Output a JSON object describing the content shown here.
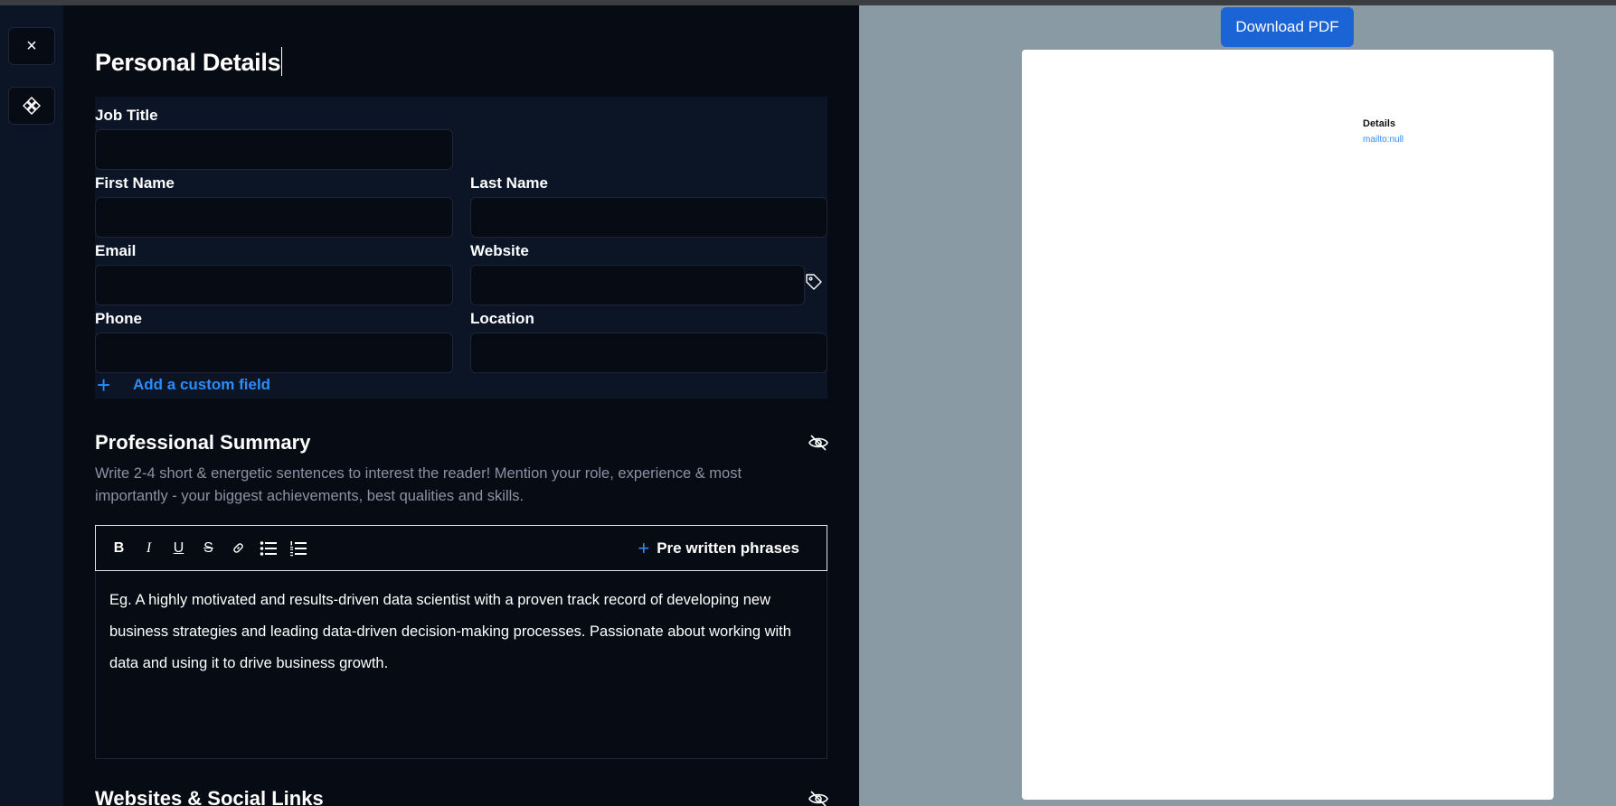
{
  "rail": {
    "close_glyph": "×"
  },
  "editor": {
    "title": "Personal Details",
    "fields": {
      "job_title": {
        "label": "Job Title",
        "value": ""
      },
      "first_name": {
        "label": "First Name",
        "value": ""
      },
      "last_name": {
        "label": "Last Name",
        "value": ""
      },
      "email": {
        "label": "Email",
        "value": ""
      },
      "website": {
        "label": "Website",
        "value": ""
      },
      "phone": {
        "label": "Phone",
        "value": ""
      },
      "location": {
        "label": "Location",
        "value": ""
      }
    },
    "add_custom_field": "Add a custom field",
    "plus_glyph": "+",
    "professional_summary": {
      "title": "Professional Summary",
      "hint": "Write 2-4 short & energetic sentences to interest the reader! Mention your role, experience & most importantly - your biggest achievements, best qualities and skills.",
      "toolbar": {
        "bold": "B",
        "italic": "I",
        "underline": "U",
        "strike": "S",
        "pre_written": "Pre written phrases"
      },
      "placeholder": "Eg. A highly motivated and results-driven data scientist with a proven track record of developing new business strategies and leading data-driven decision-making processes. Passionate about working with data and using it to drive business growth."
    },
    "websites_section": {
      "title": "Websites & Social Links"
    }
  },
  "preview": {
    "download_label": "Download PDF",
    "paper": {
      "heading": "Details",
      "link": "mailto:null"
    }
  },
  "colors": {
    "accent": "#2b8cff",
    "download_button": "#1a64d6",
    "editor_bg": "#060b14",
    "panel_bg": "#0b1526",
    "preview_bg": "#8a9aa5"
  },
  "icons": [
    "close-icon",
    "layout-icon",
    "tag-icon",
    "eye-off-icon",
    "link-icon",
    "bullet-list-icon",
    "numbered-list-icon",
    "plus-icon"
  ]
}
